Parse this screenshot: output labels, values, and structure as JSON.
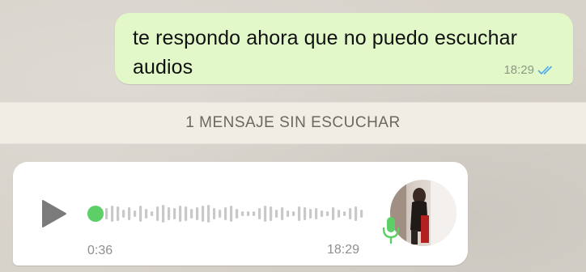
{
  "outgoing_message": {
    "text": "te respondo ahora que no puedo escuchar audios",
    "time": "18:29",
    "status_icon": "double-check-read-icon",
    "bubble_color": "#e2f8c9"
  },
  "unread_divider": {
    "label": "1 MENSAJE SIN ESCUCHAR"
  },
  "voice_message": {
    "duration": "0:36",
    "time": "18:29",
    "progress": 0,
    "play_icon": "play-icon",
    "mic_icon": "microphone-icon",
    "mic_color": "#5ccf66",
    "accent": "#5ccf66",
    "waveform_icon": "waveform-icon"
  },
  "colors": {
    "read_ticks": "#4fa9ea",
    "meta_text": "#8e8e93"
  }
}
